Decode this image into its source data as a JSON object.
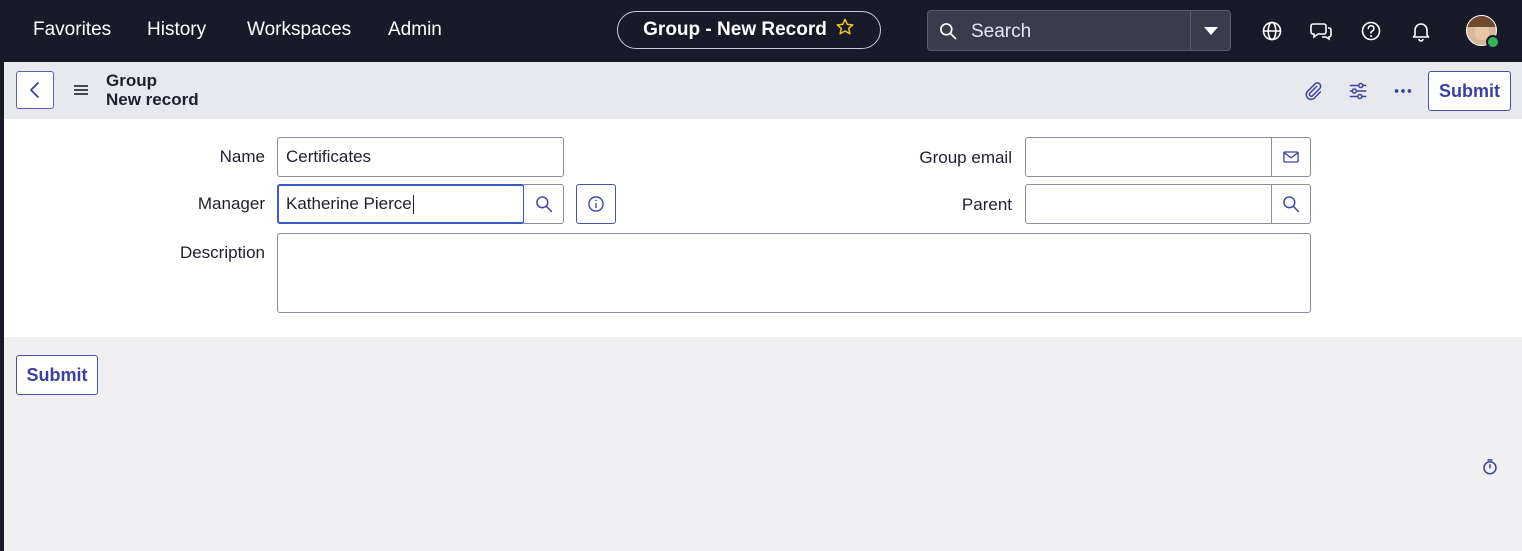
{
  "nav": {
    "items": [
      "Favorites",
      "History",
      "Workspaces",
      "Admin"
    ],
    "record_title": "Group - New Record",
    "search_placeholder": "Search"
  },
  "record": {
    "table": "Group",
    "subtitle": "New record",
    "submit_label": "Submit"
  },
  "form": {
    "name_label": "Name",
    "name_value": "Certificates",
    "manager_label": "Manager",
    "manager_value": "Katherine Pierce",
    "description_label": "Description",
    "description_value": "",
    "group_email_label": "Group email",
    "group_email_value": "",
    "parent_label": "Parent",
    "parent_value": ""
  },
  "footer": {
    "submit_label": "Submit"
  },
  "icons": [
    "star-icon",
    "search-icon",
    "dropdown-caret-icon",
    "globe-icon",
    "chat-icon",
    "help-icon",
    "bell-icon",
    "back-icon",
    "hamburger-icon",
    "paperclip-icon",
    "settings-sliders-icon",
    "more-icon",
    "mail-icon",
    "info-icon",
    "timer-icon"
  ],
  "colors": {
    "nav_bg": "#181a28",
    "accent": "#3e56c8",
    "button_text": "#3a42a0",
    "presence": "#35b35b"
  }
}
